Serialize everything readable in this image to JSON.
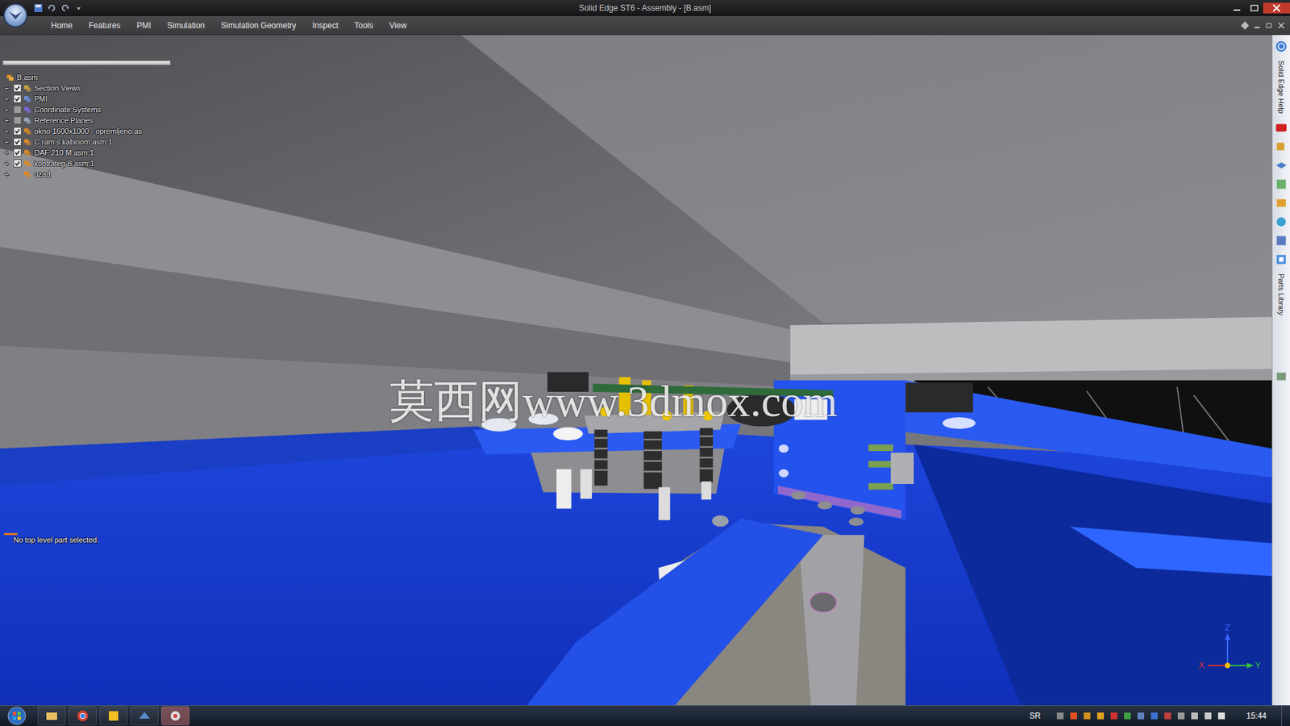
{
  "window": {
    "title": "Solid Edge ST6 - Assembly - [B.asm]"
  },
  "ribbon_tabs": [
    {
      "label": "Home",
      "selected": false
    },
    {
      "label": "Features",
      "selected": false
    },
    {
      "label": "PMI",
      "selected": false
    },
    {
      "label": "Simulation",
      "selected": false
    },
    {
      "label": "Simulation Geometry",
      "selected": false
    },
    {
      "label": "Inspect",
      "selected": false
    },
    {
      "label": "Tools",
      "selected": false
    },
    {
      "label": "View",
      "selected": false
    }
  ],
  "tree": {
    "root": "B.asm",
    "expander": "+",
    "items": [
      {
        "label": "Section Views",
        "has_checkbox": true,
        "checked": true,
        "kind": "section"
      },
      {
        "label": "PMI",
        "has_checkbox": true,
        "checked": true,
        "kind": "pmi"
      },
      {
        "label": "Coordinate Systems",
        "has_checkbox": true,
        "checked": false,
        "kind": "coord"
      },
      {
        "label": "Reference Planes",
        "has_checkbox": true,
        "checked": false,
        "kind": "planes"
      },
      {
        "label": "okno 1600x1000 - opremljeno.as",
        "has_checkbox": true,
        "checked": true,
        "kind": "assembly"
      },
      {
        "label": "C ram s kabinom.asm:1",
        "has_checkbox": true,
        "checked": true,
        "kind": "assembly"
      },
      {
        "label": "DAF 210 M.asm:1",
        "has_checkbox": true,
        "checked": true,
        "kind": "assembly"
      },
      {
        "label": "kontrateg B.asm:1",
        "has_checkbox": true,
        "checked": true,
        "kind": "assembly"
      },
      {
        "label": "uzad",
        "has_checkbox": false,
        "checked": false,
        "kind": "assembly"
      }
    ]
  },
  "status_message": "No top level part selected.",
  "watermark": "莫西网www.3dmox.com",
  "side_panel": {
    "labels": [
      "Solid Edge Help",
      "Parts Library"
    ]
  },
  "axes": {
    "z": "Z",
    "x": "X",
    "y": "Y"
  },
  "taskbar": {
    "language": "SR",
    "time": "15:44"
  }
}
